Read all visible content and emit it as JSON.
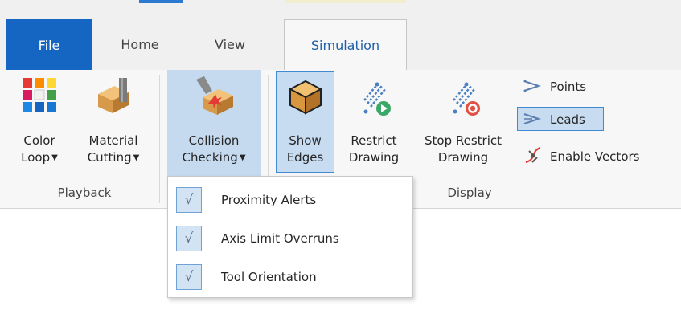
{
  "tabs": {
    "file": "File",
    "home": "Home",
    "view": "View",
    "simulation": "Simulation"
  },
  "playback": {
    "color_loop_line1": "Color",
    "color_loop_line2": "Loop",
    "material_cutting_line1": "Material",
    "material_cutting_line2": "Cutting",
    "group_label": "Playback"
  },
  "collision": {
    "line1": "Collision",
    "line2": "Checking"
  },
  "display": {
    "show_edges_line1": "Show",
    "show_edges_line2": "Edges",
    "restrict_line1": "Restrict",
    "restrict_line2": "Drawing",
    "stop_restrict_line1": "Stop Restrict",
    "stop_restrict_line2": "Drawing",
    "points": "Points",
    "leads": "Leads",
    "enable_vectors": "Enable Vectors",
    "group_label": "Display"
  },
  "dropdown": {
    "items": [
      {
        "label": "Proximity Alerts",
        "checked": true
      },
      {
        "label": "Axis Limit Overruns",
        "checked": true
      },
      {
        "label": "Tool Orientation",
        "checked": true
      }
    ],
    "check_glyph": "√"
  },
  "colors": {
    "accent": "#1566c3",
    "selected_bg": "#c7dcf0",
    "selected_border": "#3f8ad0"
  }
}
